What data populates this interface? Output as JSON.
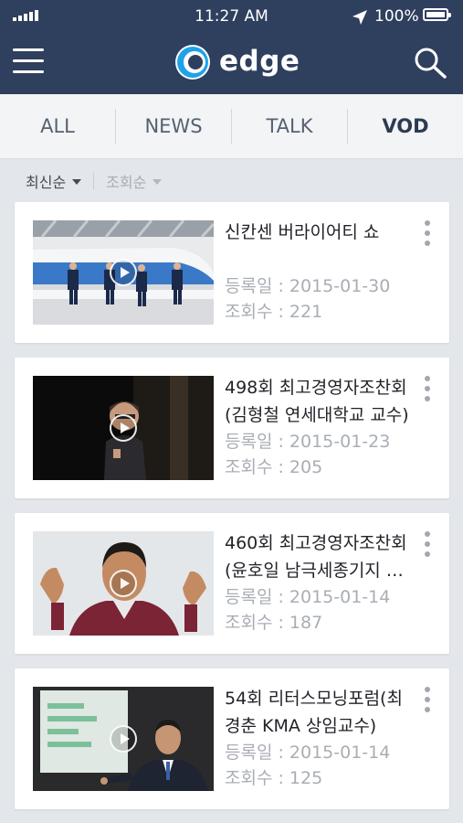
{
  "status_bar": {
    "time": "11:27 AM",
    "battery": "100%"
  },
  "app": {
    "logo_text": "edge"
  },
  "tabs": [
    {
      "label": "ALL",
      "active": false
    },
    {
      "label": "NEWS",
      "active": false
    },
    {
      "label": "TALK",
      "active": false
    },
    {
      "label": "VOD",
      "active": true
    }
  ],
  "sort": {
    "latest": "최신순",
    "views": "조회순"
  },
  "videos": [
    {
      "title": "신칸센 버라이어티 쇼",
      "date_label": "등록일 : ",
      "date": "2015-01-30",
      "views_label": "조회수 : ",
      "views": "221"
    },
    {
      "title": "498회 최고경영자조찬회(김형철 연세대학교 교수)",
      "date_label": "등록일 : ",
      "date": "2015-01-23",
      "views_label": "조회수 : ",
      "views": "205"
    },
    {
      "title": "460회 최고경영자조찬회(윤호일 남극세종기지 …",
      "date_label": "등록일 : ",
      "date": "2015-01-14",
      "views_label": "조회수 : ",
      "views": "187"
    },
    {
      "title": "54회 리터스모닝포럼(최경춘 KMA 상임교수)",
      "date_label": "등록일 : ",
      "date": "2015-01-14",
      "views_label": "조회수 : ",
      "views": "125"
    }
  ],
  "colors": {
    "header": "#2f3f5e",
    "logo_accent": "#1fa3e8",
    "active_tab": "#2d3b52"
  }
}
